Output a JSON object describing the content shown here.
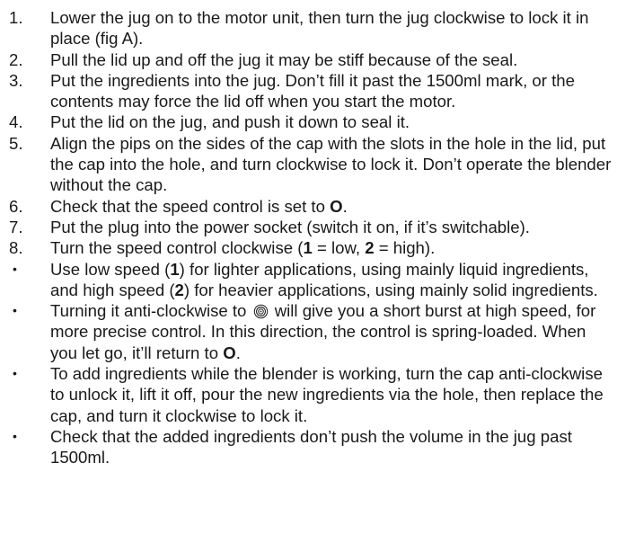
{
  "steps": [
    {
      "marker": "1.",
      "segments": [
        {
          "text": "Lower the jug on to the motor unit, then turn the jug clockwise to lock it in place (fig A)."
        }
      ]
    },
    {
      "marker": "2.",
      "segments": [
        {
          "text": "Pull the lid up and off the jug it may be stiff because of the seal."
        }
      ]
    },
    {
      "marker": "3.",
      "segments": [
        {
          "text": "Put the ingredients into the jug. Don’t fill it past the 1500ml mark, or the contents may force the lid off when you start the motor."
        }
      ]
    },
    {
      "marker": "4.",
      "segments": [
        {
          "text": "Put the lid on the jug, and push it down to seal it."
        }
      ]
    },
    {
      "marker": "5.",
      "segments": [
        {
          "text": "Align the pips on the sides of the cap with the slots in the hole in the lid, put the cap into the hole, and turn clockwise to lock it. Don’t operate the blender without the cap."
        }
      ]
    },
    {
      "marker": "6.",
      "segments": [
        {
          "text": "Check that the speed control is set to "
        },
        {
          "text": "O",
          "bold": true
        },
        {
          "text": "."
        }
      ]
    },
    {
      "marker": "7.",
      "segments": [
        {
          "text": "Put the plug into the power socket (switch it on, if it’s switchable)."
        }
      ]
    },
    {
      "marker": "8.",
      "segments": [
        {
          "text": "Turn the speed control clockwise ("
        },
        {
          "text": "1",
          "bold": true
        },
        {
          "text": " = low, "
        },
        {
          "text": "2",
          "bold": true
        },
        {
          "text": " = high)."
        }
      ]
    },
    {
      "marker": "•",
      "bullet": true,
      "segments": [
        {
          "text": "Use low speed ("
        },
        {
          "text": "1",
          "bold": true
        },
        {
          "text": ") for lighter applications, using mainly liquid ingredients, and high speed ("
        },
        {
          "text": "2",
          "bold": true
        },
        {
          "text": ") for heavier applications, using mainly solid ingredients."
        }
      ]
    },
    {
      "marker": "•",
      "bullet": true,
      "segments": [
        {
          "text": "Turning it anti-clockwise to "
        },
        {
          "icon": "pulse-icon"
        },
        {
          "text": " will give you a short burst at high speed, for more precise control. In this direction, the control is spring-loaded. When you let go, it’ll return to "
        },
        {
          "text": "O",
          "bold": true
        },
        {
          "text": "."
        }
      ]
    },
    {
      "marker": "•",
      "bullet": true,
      "segments": [
        {
          "text": "To add ingredients while the blender is working, turn the cap anti-clockwise to unlock it, lift it off, pour the new ingredients via the hole, then replace the cap, and turn it clockwise to lock it."
        }
      ]
    },
    {
      "marker": "•",
      "bullet": true,
      "segments": [
        {
          "text": "Check that the added ingredients don’t push the volume in the jug past 1500ml."
        }
      ]
    }
  ]
}
